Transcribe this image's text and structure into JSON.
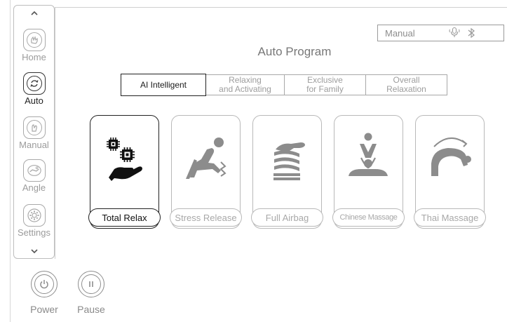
{
  "sidebar": {
    "items": [
      {
        "label": "Home",
        "icon": "home-hand-icon",
        "active": false
      },
      {
        "label": "Auto",
        "icon": "auto-cycle-icon",
        "active": true
      },
      {
        "label": "Manual",
        "icon": "manual-hand-icon",
        "active": false
      },
      {
        "label": "Angle",
        "icon": "angle-chair-icon",
        "active": false
      },
      {
        "label": "Settings",
        "icon": "settings-gear-icon",
        "active": false
      }
    ]
  },
  "status": {
    "mode": "Manual",
    "icons": [
      "microphone-icon",
      "bluetooth-icon"
    ]
  },
  "page_title": "Auto Program",
  "tabs": [
    {
      "label": "AI Intelligent",
      "active": true
    },
    {
      "label": "Relaxing\nand Activating",
      "active": false
    },
    {
      "label": "Exclusive\nfor Family",
      "active": false
    },
    {
      "label": "Overall\nRelaxation",
      "active": false
    }
  ],
  "programs": [
    {
      "label": "Total Relax",
      "icon": "ai-chip-hand-icon",
      "active": true
    },
    {
      "label": "Stress Release",
      "icon": "reclining-person-icon",
      "active": false
    },
    {
      "label": "Full Airbag",
      "icon": "airbag-waves-icon",
      "active": false
    },
    {
      "label": "Chinese Massage",
      "icon": "chinese-massage-icon",
      "active": false
    },
    {
      "label": "Thai Massage",
      "icon": "thai-stretch-icon",
      "active": false
    }
  ],
  "bottom": {
    "power": "Power",
    "pause": "Pause"
  },
  "colors": {
    "active": "#222222",
    "inactive": "#a8a8a8",
    "icon_gray": "#8c8c8c"
  }
}
